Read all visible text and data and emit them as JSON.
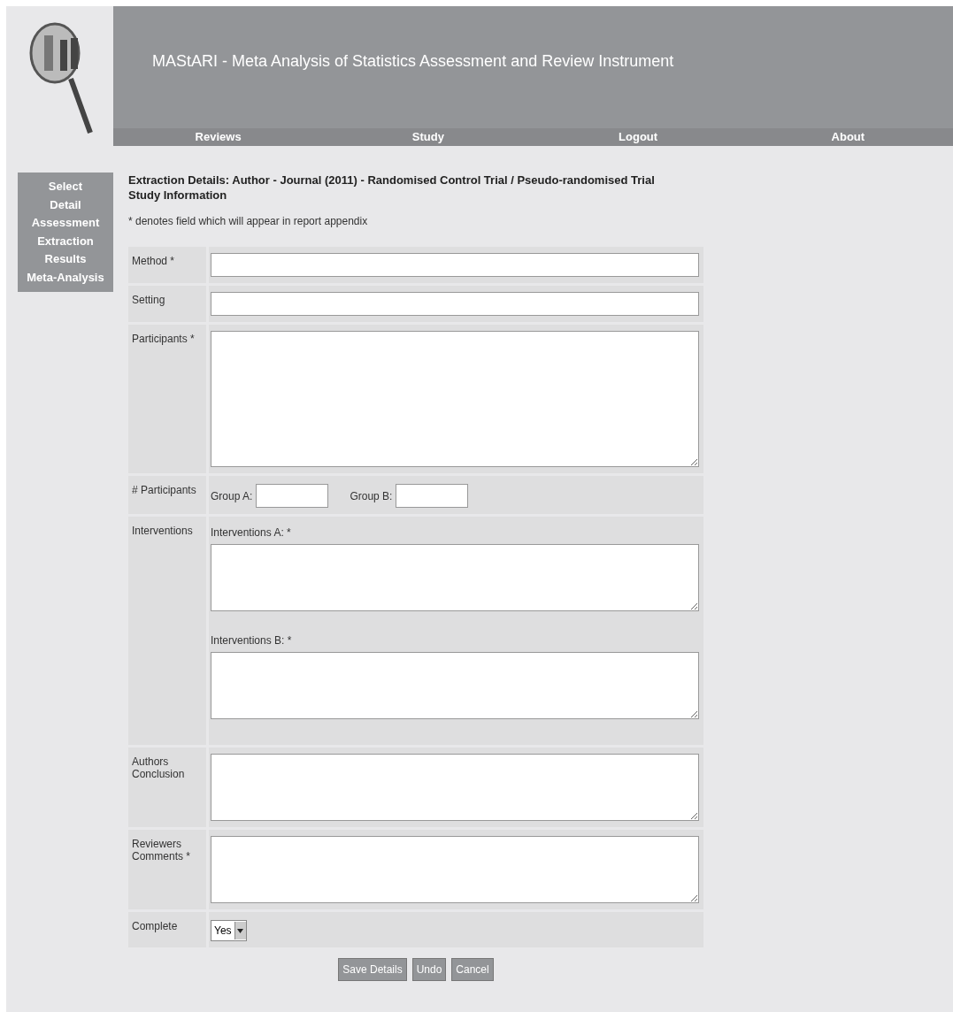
{
  "header": {
    "title": "MAStARI - Meta Analysis of Statistics Assessment and Review Instrument"
  },
  "nav": [
    {
      "label": "Reviews"
    },
    {
      "label": "Study"
    },
    {
      "label": "Logout"
    },
    {
      "label": "About"
    }
  ],
  "sidebar": {
    "items": [
      {
        "label": "Select"
      },
      {
        "label": "Detail"
      },
      {
        "label": "Assessment"
      },
      {
        "label": "Extraction"
      },
      {
        "label": "Results"
      },
      {
        "label": "Meta-Analysis"
      }
    ]
  },
  "page": {
    "heading": "Extraction Details: Author - Journal (2011) - Randomised Control Trial / Pseudo-randomised Trial",
    "subheading": "Study Information",
    "note": "* denotes field which will appear in report appendix"
  },
  "form": {
    "rows": [
      {
        "kind": "text",
        "label": "Method *"
      },
      {
        "kind": "text",
        "label": "Setting"
      },
      {
        "kind": "textarea",
        "label": "Participants *"
      },
      {
        "kind": "groups",
        "label": "# Participants",
        "groups": [
          {
            "label": "Group A:"
          },
          {
            "label": "Group B:"
          }
        ]
      },
      {
        "kind": "multi",
        "label": "Interventions",
        "parts": [
          {
            "label": "Interventions A: *"
          },
          {
            "label": "Interventions B: *"
          }
        ]
      },
      {
        "kind": "textarea",
        "label": "Authors Conclusion"
      },
      {
        "kind": "textarea",
        "label": "Reviewers Comments *"
      },
      {
        "kind": "select",
        "label": "Complete",
        "value": "Yes"
      }
    ]
  },
  "buttons": [
    {
      "label": "Save Details"
    },
    {
      "label": "Undo"
    },
    {
      "label": "Cancel"
    }
  ]
}
